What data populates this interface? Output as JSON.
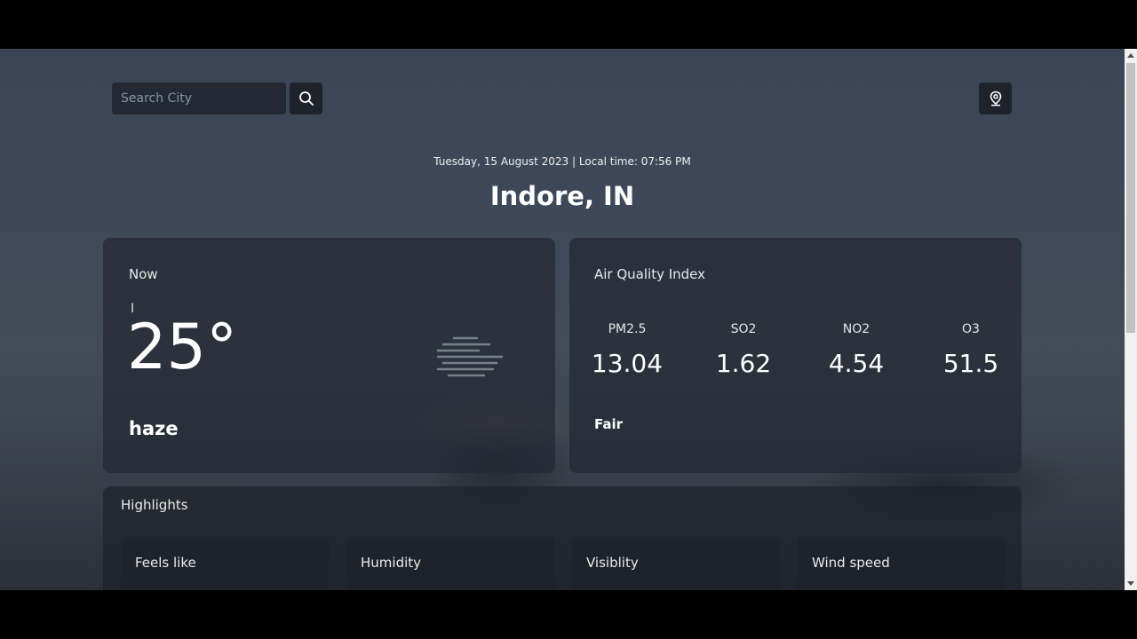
{
  "search": {
    "placeholder": "Search City"
  },
  "header": {
    "date_line": "Tuesday, 15 August 2023 | Local time: 07:56 PM",
    "city": "Indore, IN"
  },
  "now": {
    "title": "Now",
    "temperature": "25°",
    "description": "haze",
    "icon": "haze-icon"
  },
  "aqi": {
    "title": "Air Quality Index",
    "items": [
      {
        "label": "PM2.5",
        "value": "13.04"
      },
      {
        "label": "SO2",
        "value": "1.62"
      },
      {
        "label": "NO2",
        "value": "4.54"
      },
      {
        "label": "O3",
        "value": "51.5"
      }
    ],
    "status": "Fair"
  },
  "highlights": {
    "title": "Highlights",
    "tiles": [
      {
        "label": "Feels like"
      },
      {
        "label": "Humidity"
      },
      {
        "label": "Visiblity"
      },
      {
        "label": "Wind speed"
      }
    ]
  },
  "icons": {
    "search": "search-icon",
    "location": "location-pin-icon"
  }
}
